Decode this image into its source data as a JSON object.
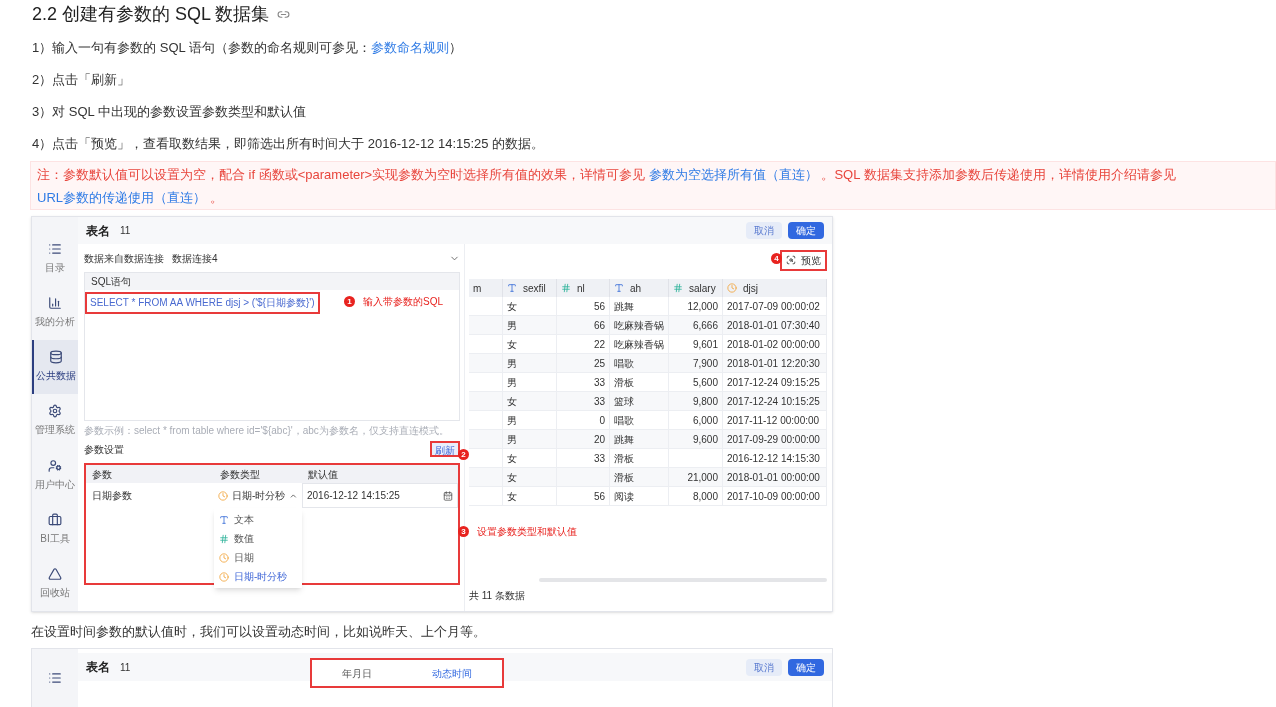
{
  "heading": "2.2 创建有参数的 SQL 数据集",
  "steps": [
    {
      "parts": [
        {
          "kind": "text",
          "text": "1）输入一句有参数的 SQL 语句（参数的命名规则可参见："
        },
        {
          "kind": "link",
          "text": "参数命名规则"
        },
        {
          "kind": "text",
          "text": "）"
        }
      ]
    },
    {
      "parts": [
        {
          "kind": "text",
          "text": "2）点击「刷新」"
        }
      ]
    },
    {
      "parts": [
        {
          "kind": "text",
          "text": "3）对 SQL 中出现的参数设置参数类型和默认值"
        }
      ]
    },
    {
      "parts": [
        {
          "kind": "text",
          "text": "4）点击「预览」，查看取数结果，即筛选出所有时间大于 2016-12-12 14:15:25 的数据。"
        }
      ]
    }
  ],
  "note": {
    "parts": [
      {
        "kind": "text",
        "text": "注：参数默认值可以设置为空，配合 if 函数或<parameter>实现参数为空时选择所有值的效果，详情可参见 "
      },
      {
        "kind": "link",
        "text": "参数为空选择所有值（直连）"
      },
      {
        "kind": "text",
        "text": " 。SQL 数据集支持添加参数后传递使用，详情使用介绍请参见 "
      },
      {
        "kind": "link",
        "text": "URL参数的传递使用（直连）"
      },
      {
        "kind": "text",
        "text": " 。"
      }
    ]
  },
  "screenshot": {
    "nav": [
      {
        "label": "目录",
        "kind": "list",
        "selected": false
      },
      {
        "label": "我的分析",
        "kind": "chart",
        "selected": false
      },
      {
        "label": "公共数据",
        "kind": "data",
        "selected": true
      },
      {
        "label": "管理系统",
        "kind": "gear",
        "selected": false
      },
      {
        "label": "用户中心",
        "kind": "user",
        "selected": false
      },
      {
        "label": "BI工具",
        "kind": "toolbox",
        "selected": false
      },
      {
        "label": "回收站",
        "kind": "recycle",
        "selected": false
      }
    ],
    "table_name_label": "表名",
    "table_name": "11",
    "buttons": [
      {
        "label": "取消",
        "kind": "secondary"
      },
      {
        "label": "确定",
        "kind": "primary"
      }
    ],
    "connection_label": "数据来自数据连接",
    "connection_value": "数据连接4",
    "sql_header": "SQL语句",
    "sql": "SELECT * FROM AA WHERE djsj > ('${日期参数}')",
    "hint": "参数示例：select * from table where id='${abc}'，abc为参数名，仅支持直连模式。",
    "params_title": "参数设置",
    "refresh": "刷新",
    "param_columns": [
      "参数",
      "参数类型",
      "默认值"
    ],
    "param_rows": [
      {
        "name": "日期参数",
        "type": "日期-时分秒",
        "expanded": true,
        "default": "2016-12-12 14:15:25"
      }
    ],
    "type_options": [
      {
        "label": "文本",
        "kind": "text",
        "selected": false
      },
      {
        "label": "数值",
        "kind": "number",
        "selected": false
      },
      {
        "label": "日期",
        "kind": "date",
        "selected": false
      },
      {
        "label": "日期-时分秒",
        "kind": "date",
        "selected": true
      }
    ],
    "preview": "预览",
    "columns": [
      {
        "label": "m",
        "kind": "plain"
      },
      {
        "label": "sexfil",
        "kind": "text"
      },
      {
        "label": "nl",
        "kind": "number"
      },
      {
        "label": "ah",
        "kind": "text"
      },
      {
        "label": "salary",
        "kind": "number"
      },
      {
        "label": "djsj",
        "kind": "date"
      }
    ],
    "rows": [
      [
        "",
        "女",
        "56",
        "跳舞",
        "12,000",
        "2017-07-09 00:00:02"
      ],
      [
        "",
        "男",
        "66",
        "吃麻辣香锅",
        "6,666",
        "2018-01-01 07:30:40"
      ],
      [
        "",
        "女",
        "22",
        "吃麻辣香锅",
        "9,601",
        "2018-01-02 00:00:00"
      ],
      [
        "",
        "男",
        "25",
        "唱歌",
        "7,900",
        "2018-01-01 12:20:30"
      ],
      [
        "",
        "男",
        "33",
        "滑板",
        "5,600",
        "2017-12-24 09:15:25"
      ],
      [
        "",
        "女",
        "33",
        "篮球",
        "9,800",
        "2017-12-24 10:15:25"
      ],
      [
        "",
        "男",
        "0",
        "唱歌",
        "6,000",
        "2017-11-12 00:00:00"
      ],
      [
        "",
        "男",
        "20",
        "跳舞",
        "9,600",
        "2017-09-29 00:00:00"
      ],
      [
        "",
        "女",
        "33",
        "滑板",
        "",
        "2016-12-12 14:15:30"
      ],
      [
        "",
        "女",
        "",
        "滑板",
        "21,000",
        "2018-01-01 00:00:00"
      ],
      [
        "",
        "女",
        "56",
        "阅读",
        "8,000",
        "2017-10-09 00:00:00"
      ]
    ],
    "footer": "共 11 条数据",
    "annotations": [
      {
        "number": "1",
        "text": "输入带参数的SQL"
      },
      {
        "number": "2"
      },
      {
        "number": "3",
        "text": "设置参数类型和默认值"
      },
      {
        "number": "4"
      }
    ]
  },
  "caption": "在设置时间参数的默认值时，我们可以设置动态时间，比如说昨天、上个月等。",
  "screenshot2": {
    "table_name_label": "表名",
    "table_name": "11",
    "tabs": [
      {
        "label": "年月日",
        "selected": false
      },
      {
        "label": "动态时间",
        "selected": true
      }
    ],
    "buttons": [
      {
        "label": "取消",
        "kind": "secondary"
      },
      {
        "label": "确定",
        "kind": "primary"
      }
    ]
  }
}
